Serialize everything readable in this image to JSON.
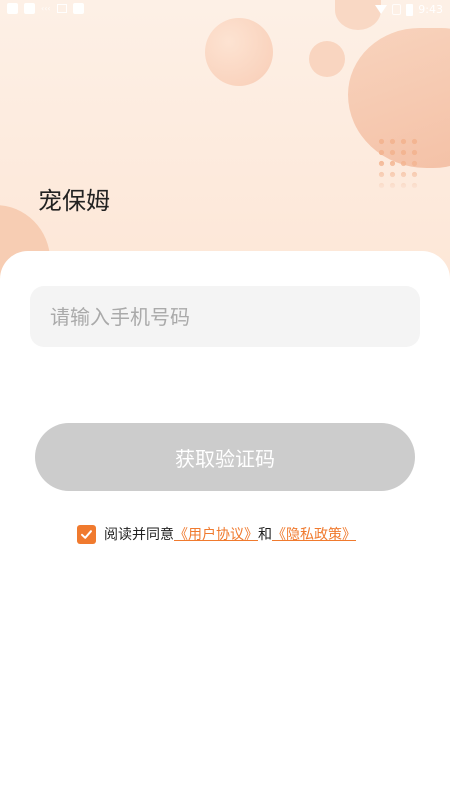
{
  "status_bar": {
    "left_text": "‹‹‹",
    "time": "9:43"
  },
  "app": {
    "title": "宠保姆"
  },
  "login": {
    "phone_placeholder": "请输入手机号码",
    "phone_value": "",
    "get_code_label": "获取验证码"
  },
  "agreement": {
    "checked": true,
    "prefix": "阅读并同意",
    "user_agreement": "《用户协议》",
    "conjunction": "和",
    "privacy_policy": "《隐私政策》"
  },
  "colors": {
    "accent": "#f07a2e",
    "button_disabled": "#cccccc",
    "hero_background": "#fdeadb",
    "input_background": "#f4f4f4"
  },
  "icons": {
    "checkbox": "check-icon",
    "wifi": "wifi-icon",
    "battery": "battery-icon"
  }
}
